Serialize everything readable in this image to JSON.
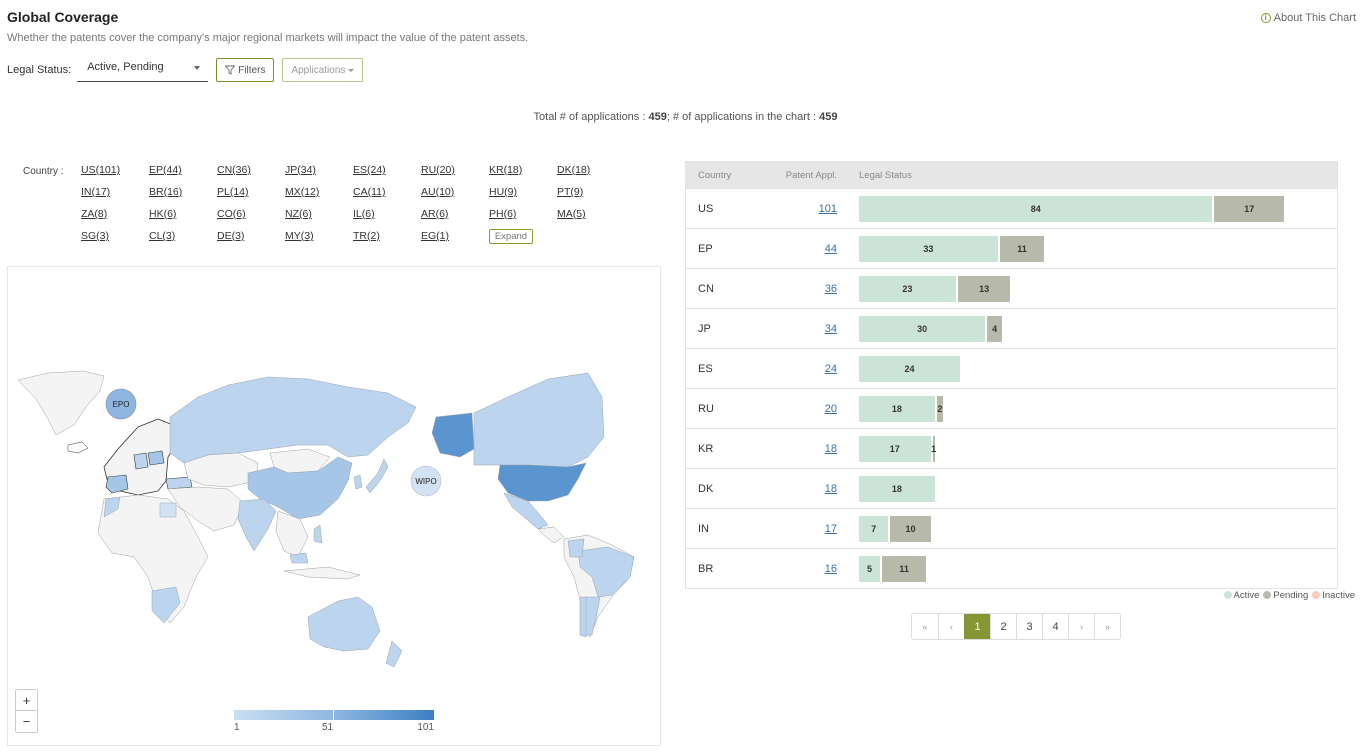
{
  "header": {
    "title": "Global Coverage",
    "subtitle": "Whether the patents cover the company's major regional markets will impact the value of the patent assets.",
    "about_label": "About This Chart",
    "about_icon": "info-circle-icon"
  },
  "controls": {
    "legal_status_label": "Legal Status:",
    "legal_status_value": "Active, Pending",
    "filters_label": "Filters",
    "filters_icon": "funnel-icon",
    "applications_label": "Applications"
  },
  "totals": {
    "prefix": "Total # of applications : ",
    "total": "459",
    "middle": "; # of applications in the chart : ",
    "in_chart": "459"
  },
  "countries": {
    "label": "Country :",
    "items": [
      "US(101)",
      "EP(44)",
      "CN(36)",
      "JP(34)",
      "ES(24)",
      "RU(20)",
      "KR(18)",
      "DK(18)",
      "IN(17)",
      "BR(16)",
      "PL(14)",
      "MX(12)",
      "CA(11)",
      "AU(10)",
      "HU(9)",
      "PT(9)",
      "ZA(8)",
      "HK(6)",
      "CO(6)",
      "NZ(6)",
      "IL(6)",
      "AR(6)",
      "PH(6)",
      "MA(5)",
      "SG(3)",
      "CL(3)",
      "DE(3)",
      "MY(3)",
      "TR(2)",
      "EG(1)"
    ],
    "expand_label": "Expand"
  },
  "map": {
    "zoom_in": "+",
    "zoom_out": "−",
    "epo_label": "EPO",
    "wipo_label": "WIPO",
    "scale_min": "1",
    "scale_mid": "51",
    "scale_max": "101",
    "colors": {
      "none": "#f4f4f4",
      "low": "#bcd4ee",
      "mid": "#a6c6e8",
      "high": "#5a95d0",
      "epo": "#8eb6e1",
      "wipo": "#d2e2f3"
    }
  },
  "table": {
    "headers": {
      "country": "Country",
      "appl": "Patent Appl.",
      "status": "Legal Status"
    },
    "rows": [
      {
        "country": "US",
        "appl": "101",
        "active": 84,
        "pending": 17
      },
      {
        "country": "EP",
        "appl": "44",
        "active": 33,
        "pending": 11
      },
      {
        "country": "CN",
        "appl": "36",
        "active": 23,
        "pending": 13
      },
      {
        "country": "JP",
        "appl": "34",
        "active": 30,
        "pending": 4
      },
      {
        "country": "ES",
        "appl": "24",
        "active": 24,
        "pending": 0
      },
      {
        "country": "RU",
        "appl": "20",
        "active": 18,
        "pending": 2
      },
      {
        "country": "KR",
        "appl": "18",
        "active": 17,
        "pending": 1
      },
      {
        "country": "DK",
        "appl": "18",
        "active": 18,
        "pending": 0
      },
      {
        "country": "IN",
        "appl": "17",
        "active": 7,
        "pending": 10
      },
      {
        "country": "BR",
        "appl": "16",
        "active": 5,
        "pending": 11
      }
    ]
  },
  "status_legend": [
    {
      "label": "Active",
      "color": "#cce3d8"
    },
    {
      "label": "Pending",
      "color": "#b7b9aa"
    },
    {
      "label": "Inactive",
      "color": "#f5cdbf"
    }
  ],
  "pager": {
    "first": "«",
    "prev": "‹",
    "pages": [
      "1",
      "2",
      "3",
      "4"
    ],
    "current": "1",
    "next": "›",
    "last": "»"
  }
}
